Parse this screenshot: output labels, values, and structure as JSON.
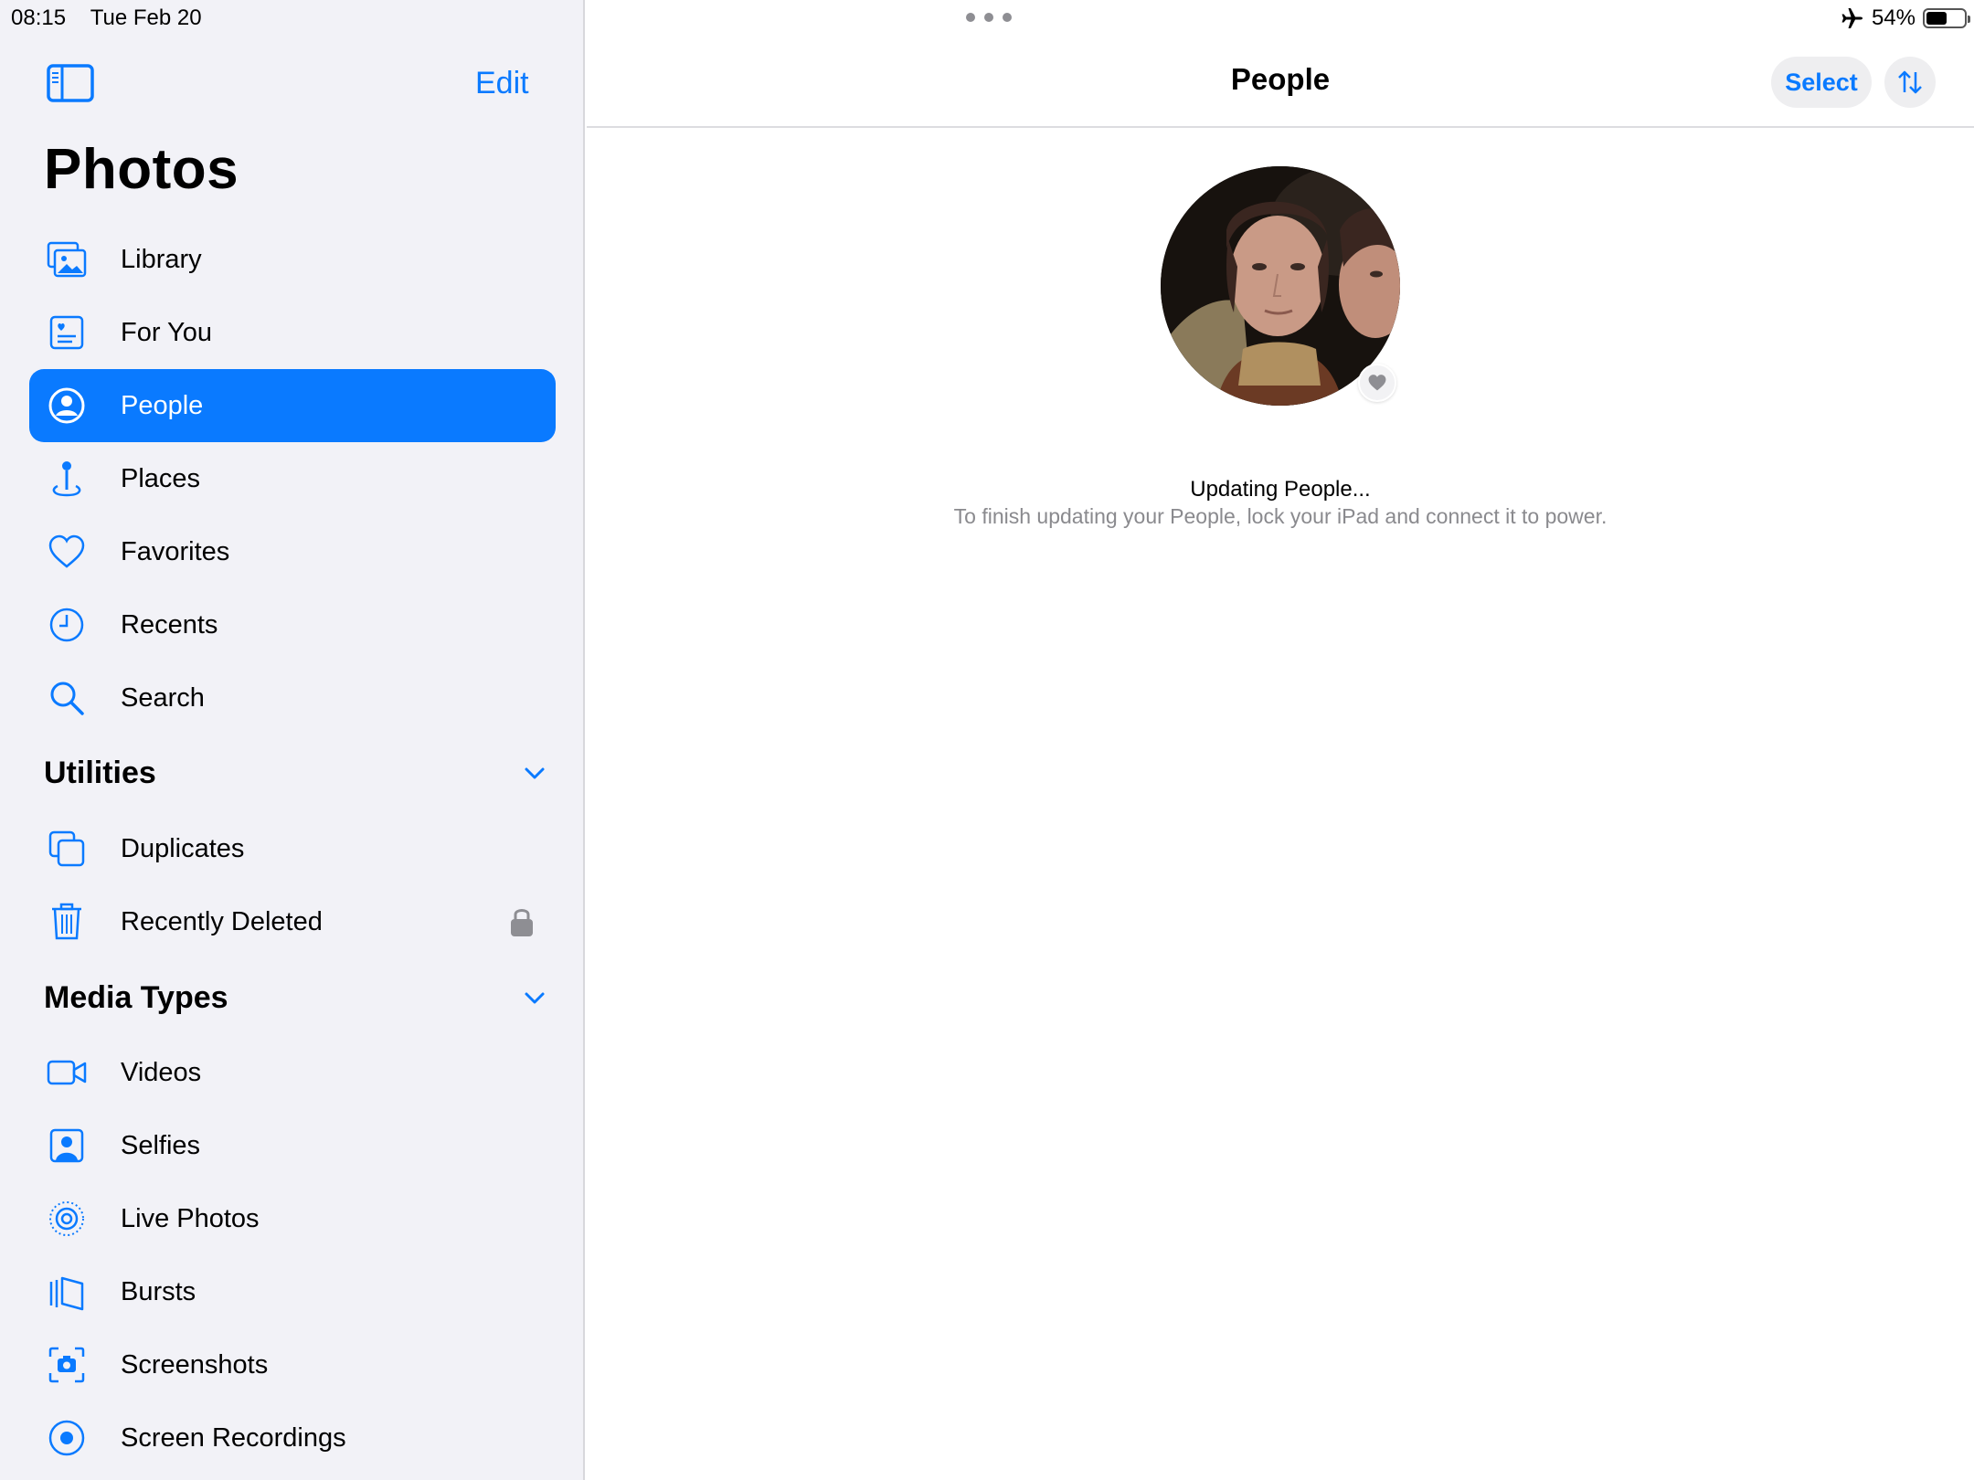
{
  "status_bar": {
    "time": "08:15",
    "date": "Tue Feb 20",
    "battery_percent": "54%",
    "battery_level": 0.54,
    "airplane_mode": true
  },
  "sidebar": {
    "edit_label": "Edit",
    "title": "Photos",
    "items": [
      {
        "label": "Library",
        "icon": "photo-library-icon"
      },
      {
        "label": "For You",
        "icon": "for-you-icon"
      },
      {
        "label": "People",
        "icon": "person-circle-icon",
        "active": true
      },
      {
        "label": "Places",
        "icon": "map-pin-icon"
      },
      {
        "label": "Favorites",
        "icon": "heart-icon"
      },
      {
        "label": "Recents",
        "icon": "clock-icon"
      },
      {
        "label": "Search",
        "icon": "search-icon"
      }
    ],
    "utilities": {
      "title": "Utilities",
      "items": [
        {
          "label": "Duplicates",
          "icon": "duplicates-icon"
        },
        {
          "label": "Recently Deleted",
          "icon": "trash-icon",
          "locked": true
        }
      ]
    },
    "media_types": {
      "title": "Media Types",
      "items": [
        {
          "label": "Videos",
          "icon": "video-icon"
        },
        {
          "label": "Selfies",
          "icon": "selfie-icon"
        },
        {
          "label": "Live Photos",
          "icon": "live-photo-icon"
        },
        {
          "label": "Bursts",
          "icon": "bursts-icon"
        },
        {
          "label": "Screenshots",
          "icon": "screenshot-icon"
        },
        {
          "label": "Screen Recordings",
          "icon": "screen-recording-icon"
        }
      ]
    }
  },
  "main": {
    "title": "People",
    "select_label": "Select",
    "update_title": "Updating People...",
    "update_subtitle": "To finish updating your People, lock your iPad and connect it to power."
  },
  "colors": {
    "accent": "#0a7aff",
    "sidebar_bg": "#f2f2f7",
    "secondary_text": "#8a8a8e"
  }
}
